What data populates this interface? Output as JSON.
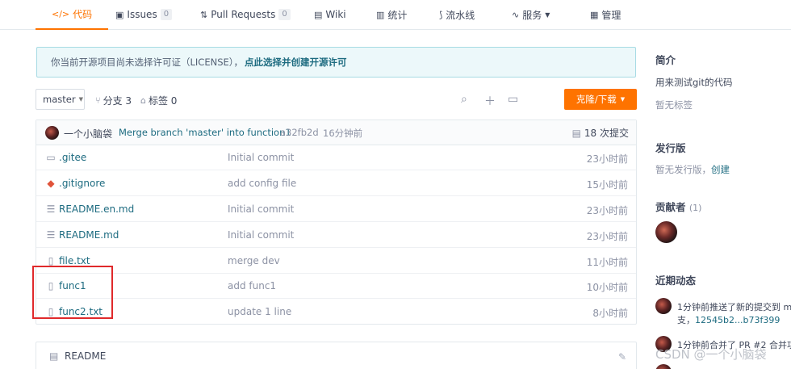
{
  "tabs": [
    {
      "icon": "</>",
      "label": "代码",
      "active": true
    },
    {
      "icon": "▣",
      "label": "Issues",
      "count": "0"
    },
    {
      "icon": "⇅",
      "label": "Pull Requests",
      "count": "0"
    },
    {
      "icon": "▤",
      "label": "Wiki"
    },
    {
      "icon": "▥",
      "label": "统计"
    },
    {
      "icon": "⟆",
      "label": "流水线"
    },
    {
      "icon": "∿",
      "label": "服务"
    },
    {
      "icon": "▦",
      "label": "管理"
    }
  ],
  "notice": {
    "text": "你当前开源项目尚未选择许可证（LICENSE），",
    "link": "点此选择并创建开源许可"
  },
  "toolbar": {
    "branch": "master",
    "branches": "分支 3",
    "tags": "标签 0",
    "clone": "克隆/下载"
  },
  "commit": {
    "author": "一个小脑袋",
    "message": "Merge branch 'master' into function1",
    "sha": "a32fb2d",
    "time": "16分钟前",
    "count": "18 次提交"
  },
  "files": [
    {
      "type": "folder-icon",
      "glyph": "▭",
      "name": ".gitee",
      "message": "Initial commit",
      "time": "23小时前"
    },
    {
      "type": "git-icon",
      "glyph": "◆",
      "name": ".gitignore",
      "message": "add config file",
      "time": "15小时前"
    },
    {
      "type": "book-icon",
      "glyph": "📖",
      "name": "README.en.md",
      "message": "Initial commit",
      "time": "23小时前"
    },
    {
      "type": "book-icon",
      "glyph": "📖",
      "name": "README.md",
      "message": "Initial commit",
      "time": "23小时前"
    },
    {
      "type": "file-icon",
      "glyph": "▯",
      "name": "file.txt",
      "message": "merge dev",
      "time": "11小时前"
    },
    {
      "type": "file-icon",
      "glyph": "▯",
      "name": "func1",
      "message": "add func1",
      "time": "10小时前"
    },
    {
      "type": "file-icon",
      "glyph": "▯",
      "name": "func2.txt",
      "message": "update 1 line",
      "time": "8小时前"
    }
  ],
  "readme": {
    "title": "README"
  },
  "sidebar": {
    "intro_title": "简介",
    "intro_text": "用来测试git的代码",
    "no_tags": "暂无标签",
    "release_title": "发行版",
    "no_release": "暂无发行版，",
    "create": "创建",
    "contributors_title": "贡献者",
    "contributors_count": "(1)",
    "activity_title": "近期动态",
    "activity": [
      {
        "line1": "1分钟前推送了新的提交到 m",
        "line2_pre": "支，",
        "line2_link": "12545b2...b73f399"
      },
      {
        "line1": "1分钟前合并了 PR #2 合并功"
      }
    ]
  },
  "watermark": "CSDN @一个小脑袋"
}
